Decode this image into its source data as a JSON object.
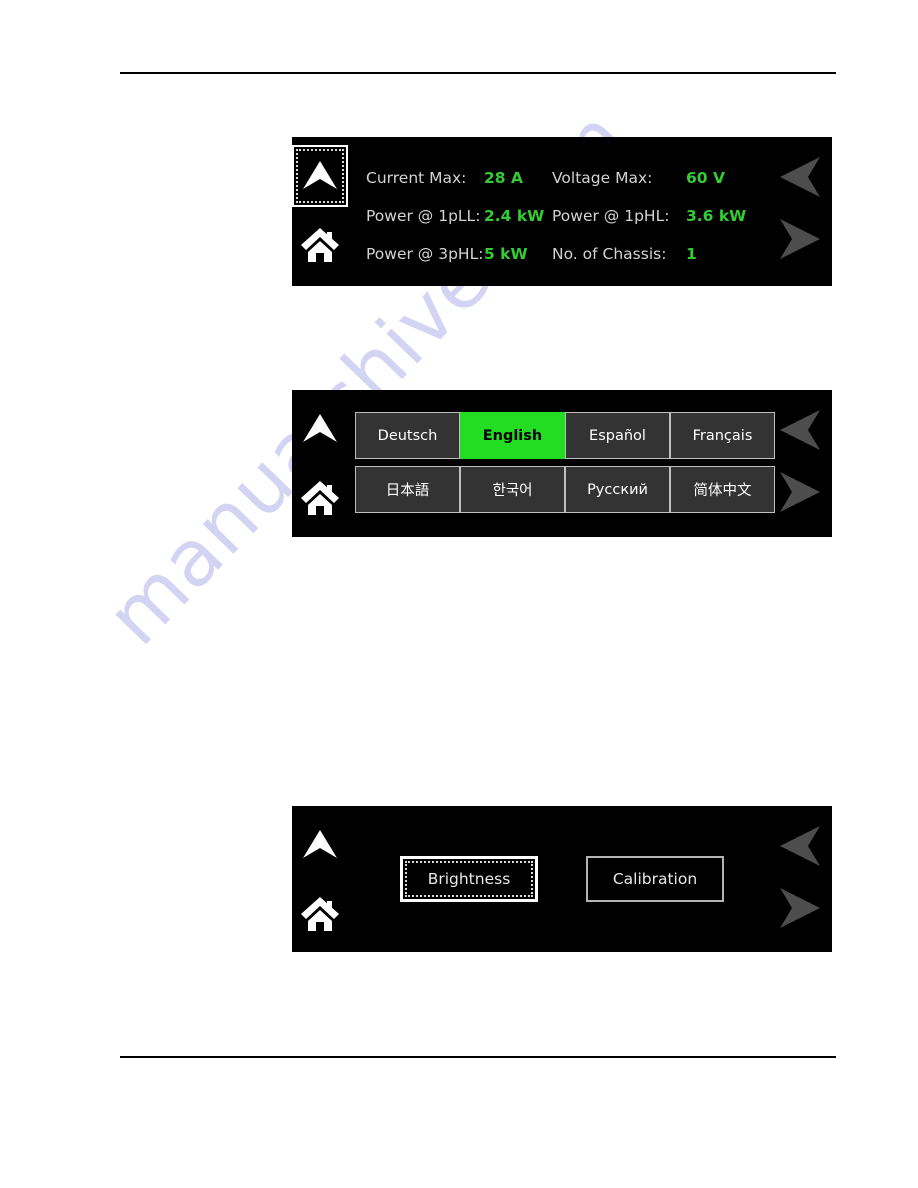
{
  "watermark": {
    "text": "manualshive.com"
  },
  "nav": {
    "up_icon": "up-arrow-icon",
    "home_icon": "home-icon",
    "prev_icon": "chevron-left-icon",
    "next_icon": "chevron-right-icon"
  },
  "panels": {
    "status": {
      "rows": [
        {
          "label1": "Current Max:",
          "value1": "28 A",
          "label2": "Voltage Max:",
          "value2": "60 V"
        },
        {
          "label1": "Power @ 1pLL:",
          "value1": "2.4 kW",
          "label2": "Power @ 1pHL:",
          "value2": "3.6 kW"
        },
        {
          "label1": "Power @ 3pHL:",
          "value1": "5 kW",
          "label2": "No. of Chassis:",
          "value2": "1"
        }
      ]
    },
    "language": {
      "buttons": [
        {
          "label": "Deutsch",
          "selected": false
        },
        {
          "label": "English",
          "selected": true
        },
        {
          "label": "Español",
          "selected": false
        },
        {
          "label": "Français",
          "selected": false
        },
        {
          "label": "日本語",
          "selected": false
        },
        {
          "label": "한국어",
          "selected": false
        },
        {
          "label": "Русский",
          "selected": false
        },
        {
          "label": "简体中文",
          "selected": false
        }
      ]
    },
    "display": {
      "brightness_label": "Brightness",
      "calibration_label": "Calibration"
    }
  },
  "colors": {
    "panel_background": "#000000",
    "value_green": "#33cc33",
    "selected_green": "#22dd22",
    "label_gray": "#d3d3d3",
    "button_gray": "#333333",
    "chevron_gray": "#4d4d4d",
    "watermark": "#ccccf2"
  }
}
